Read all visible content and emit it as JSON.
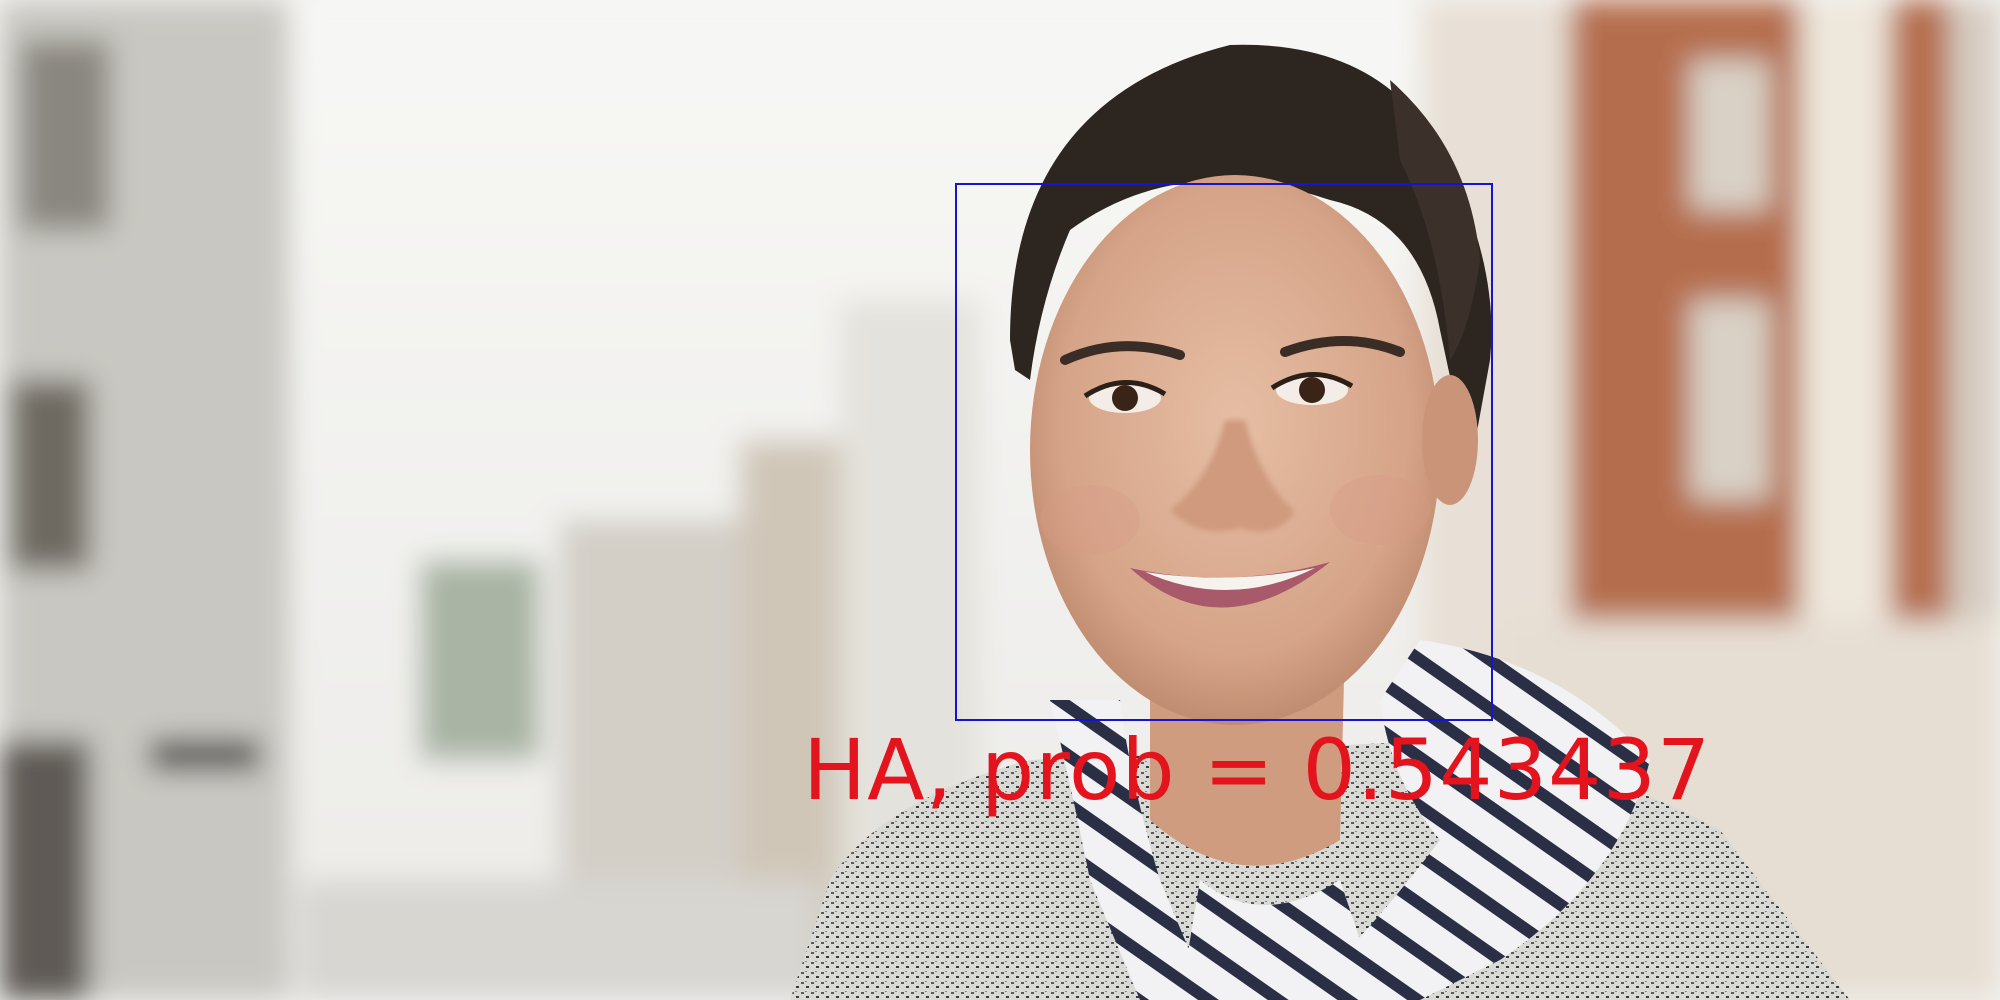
{
  "detection": {
    "label": "HA, prob = 0.543437",
    "box_color": "#1414d2",
    "text_color": "#e4141e"
  },
  "scene": {
    "icons": [
      "blurred-street-background",
      "smiling-woman-portrait",
      "striped-scarf",
      "tweed-jacket"
    ]
  }
}
